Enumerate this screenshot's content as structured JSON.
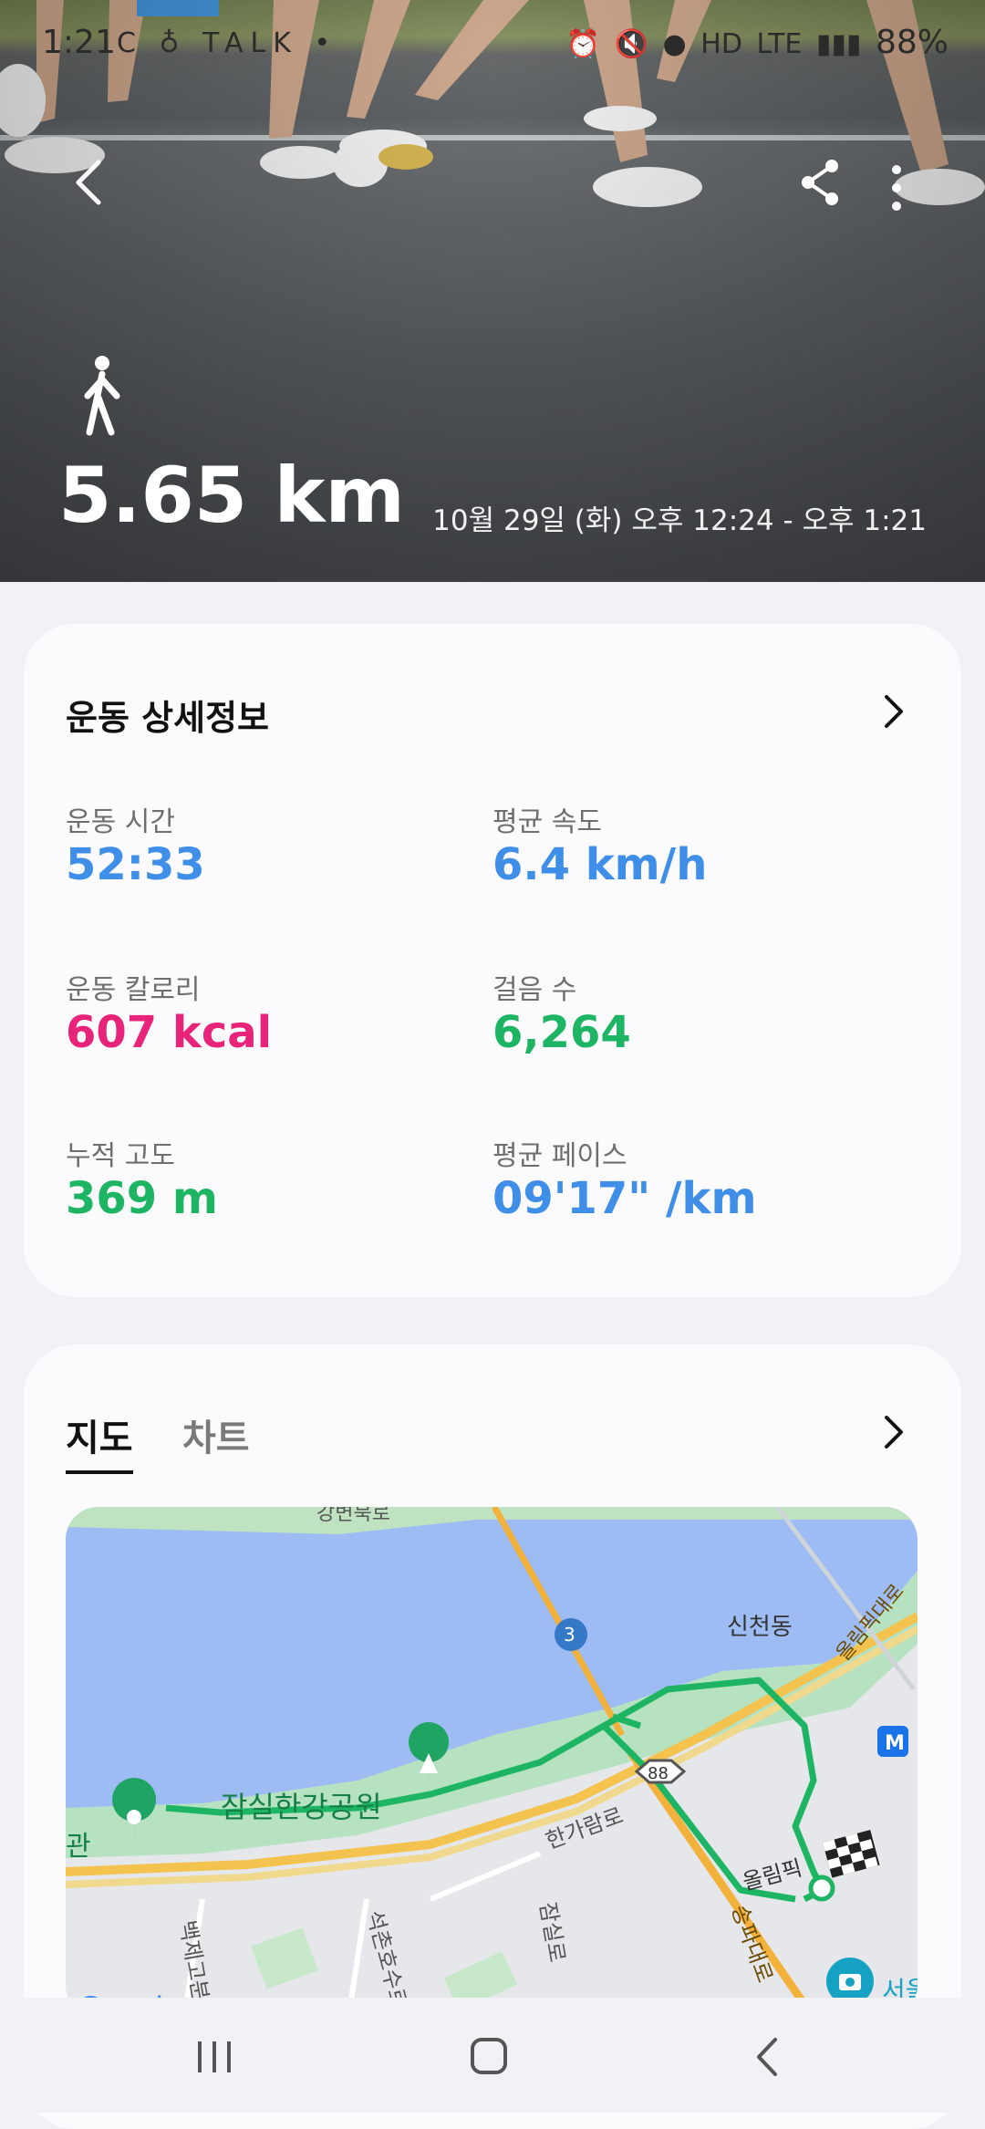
{
  "status_bar": {
    "time": "1:21",
    "left_icons": "C ♁ TALK •",
    "right_icons": [
      "⏰",
      "🔇",
      "●",
      "HD",
      "LTE",
      "▮▮▮"
    ],
    "battery": "88%"
  },
  "hero": {
    "activity_icon": "walking-person-icon",
    "distance": "5.65 km",
    "date_range": "10월 29일 (화) 오후 12:24 - 오후 1:21"
  },
  "details": {
    "title": "운동 상세정보",
    "metrics": {
      "duration": {
        "label": "운동 시간",
        "value": "52:33"
      },
      "avg_speed": {
        "label": "평균 속도",
        "value": "6.4 km/h"
      },
      "calories": {
        "label": "운동 칼로리",
        "value": "607 kcal"
      },
      "steps": {
        "label": "걸음 수",
        "value": "6,264"
      },
      "elevation": {
        "label": "누적 고도",
        "value": "369 m"
      },
      "avg_pace": {
        "label": "평균 페이스",
        "value": "09'17\" /km"
      }
    }
  },
  "map_section": {
    "tabs": [
      "지도",
      "차트"
    ],
    "labels": {
      "gangbyeonbukdo": "강변북로",
      "route3": "3",
      "sincheon": "신천동",
      "olympic_road": "올림픽대로",
      "park": "잠실한강공원",
      "route88": "88",
      "hangaram": "한가람로",
      "jamsil_ro": "잠실로",
      "songpa": "송파대로",
      "olympic_short": "올림픽",
      "seokchon": "석촌호수로",
      "baekje": "백제고분",
      "gwan": "관",
      "seoul": "서울",
      "metro": "M",
      "google": "Google"
    }
  },
  "colors": {
    "blue": "#3f8ee8",
    "pink": "#e8237a",
    "green": "#1db563",
    "route": "#1db563"
  }
}
